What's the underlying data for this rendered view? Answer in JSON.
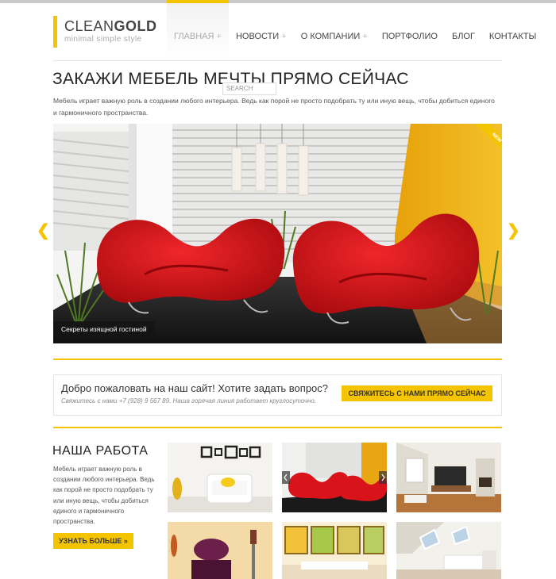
{
  "site": {
    "logo_main": "CLEAN",
    "logo_bold": "GOLD",
    "tagline": "minimal simple style"
  },
  "nav": {
    "items": [
      {
        "label": "ГЛАВНАЯ",
        "has_sub": true,
        "active": true
      },
      {
        "label": "НОВОСТИ",
        "has_sub": true,
        "active": false
      },
      {
        "label": "О КОМПАНИИ",
        "has_sub": true,
        "active": false
      },
      {
        "label": "ПОРТФОЛИО",
        "has_sub": false,
        "active": false
      },
      {
        "label": "БЛОГ",
        "has_sub": false,
        "active": false
      },
      {
        "label": "КОНТАКТЫ",
        "has_sub": false,
        "active": false
      }
    ],
    "sub_marker": "+"
  },
  "search": {
    "placeholder": "SEARCH"
  },
  "hero": {
    "title": "ЗАКАЖИ МЕБЕЛЬ МЕЧТЫ ПРЯМО СЕЙЧАС",
    "text": "Мебель играет важную роль в создании любого интерьера. Ведь как порой не просто подобрать ту или иную вещь, чтобы добиться единого и гармоничного пространства."
  },
  "slider": {
    "caption": "Секреты изящной гостиной",
    "badge": "NEW",
    "prev_arrow": "❮",
    "next_arrow": "❯"
  },
  "callout": {
    "title": "Добро пожаловать на наш сайт! Хотите задать вопрос?",
    "subtitle": "Свяжитесь с нами +7 (928) 9 567 89. Наша горячая линия работает круглосуточно.",
    "button": "СВЯЖИТЕСЬ С НАМИ ПРЯМО СЕЙЧАС"
  },
  "work": {
    "title": "НАША РАБОТА",
    "text": "Мебель играет важную роль в создании любого интерьера. Ведь как порой не просто подобрать ту или иную вещь, чтобы добиться единого и гармоничного пространства.",
    "button": "УЗНАТЬ БОЛЬШЕ »"
  },
  "colors": {
    "accent": "#f5c400",
    "chair_red": "#d8141a",
    "text_dark": "#222222"
  }
}
